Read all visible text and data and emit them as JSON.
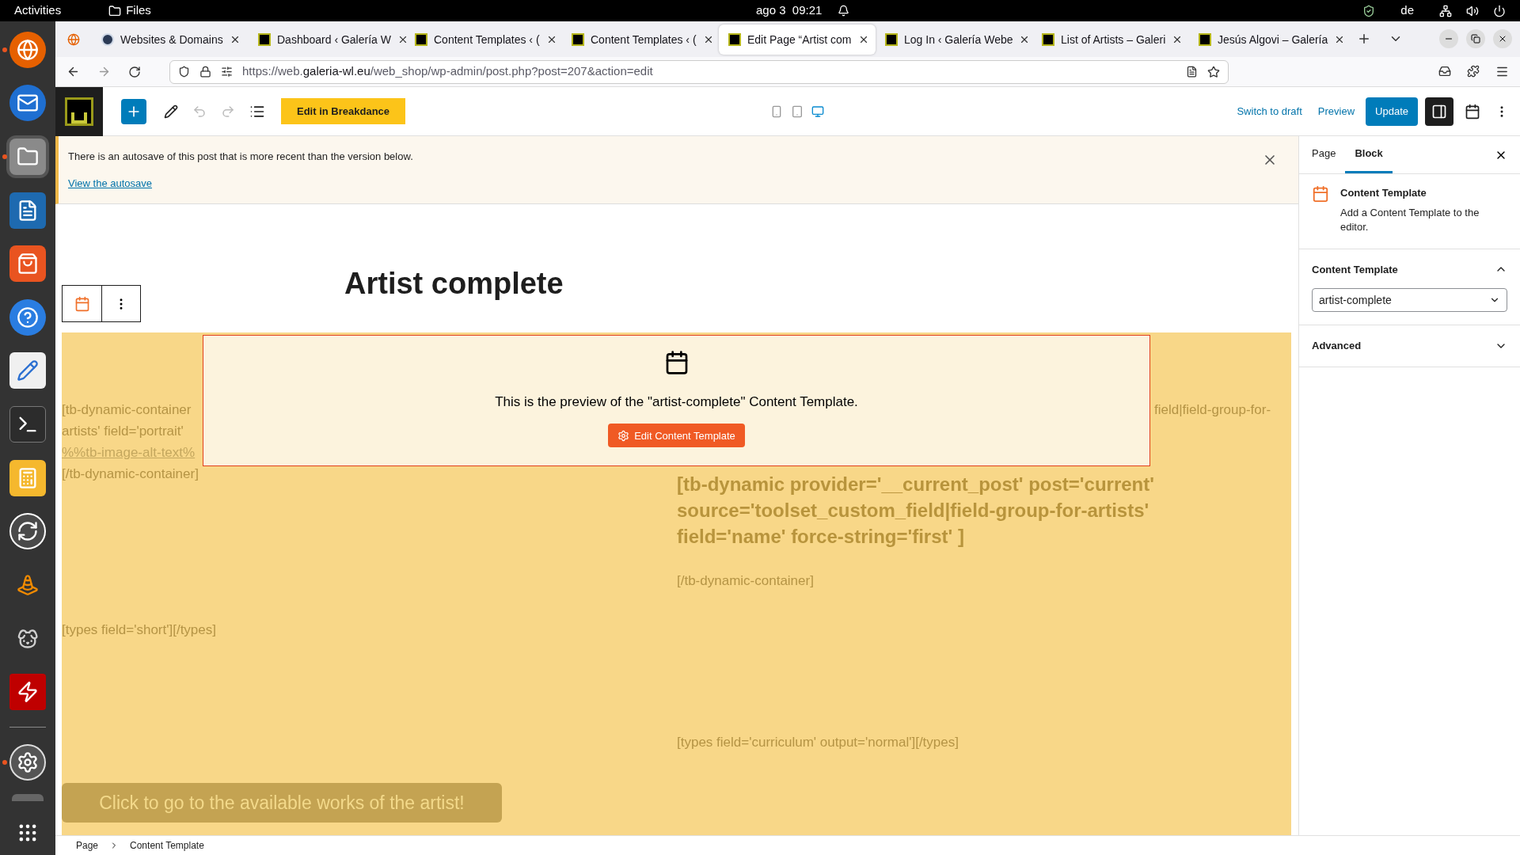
{
  "top_bar": {
    "activities": "Activities",
    "app_name": "Files",
    "clock": "ago 3  09:21",
    "keyboard_layout": "de"
  },
  "dock": [
    {
      "kind": "browser",
      "running": true
    },
    {
      "kind": "mail",
      "running": false
    },
    {
      "kind": "files",
      "running": true
    },
    {
      "kind": "writer",
      "running": false
    },
    {
      "kind": "store",
      "running": false
    },
    {
      "kind": "help",
      "running": false
    },
    {
      "kind": "editor",
      "running": false
    },
    {
      "kind": "terminal",
      "running": false
    },
    {
      "kind": "calculator",
      "running": false
    },
    {
      "kind": "updater",
      "running": false
    },
    {
      "kind": "cone",
      "running": false
    },
    {
      "kind": "dog",
      "running": false
    },
    {
      "kind": "transfer",
      "running": false
    },
    {
      "kind": "divider"
    },
    {
      "kind": "settings",
      "running": true
    },
    {
      "kind": "handle"
    },
    {
      "kind": "apps",
      "running": false
    }
  ],
  "browser": {
    "tabs": [
      {
        "title": "Websites & Domains",
        "selected": false
      },
      {
        "title": "Dashboard ‹ Galería W",
        "selected": false
      },
      {
        "title": "Content Templates ‹ (",
        "selected": false
      },
      {
        "title": "Content Templates ‹ (",
        "selected": false
      },
      {
        "title": "Edit Page “Artist com",
        "selected": true
      },
      {
        "title": "Log In ‹ Galería Webe",
        "selected": false
      },
      {
        "title": "List of Artists – Galeri",
        "selected": false
      },
      {
        "title": "Jesús Algovi – Galería",
        "selected": false
      }
    ],
    "url": {
      "prefix": "https://web.",
      "domain": "galeria-wl.eu",
      "path": "/web_shop/wp-admin/post.php?post=207&action=edit"
    }
  },
  "wp_toolbar": {
    "undo": {
      "disabled": true
    },
    "redo": {
      "disabled": true
    },
    "breakdance_button": "Edit in Breakdance",
    "devices": [
      {
        "kind": "mobile",
        "selected": false
      },
      {
        "kind": "tablet",
        "selected": false
      },
      {
        "kind": "desktop",
        "selected": true
      }
    ],
    "switch_to_draft": "Switch to draft",
    "preview": "Preview",
    "update": "Update",
    "settings_toggle": {
      "pressed": true
    }
  },
  "notice": {
    "message": "There is an autosave of this post that is more recent than the version below.",
    "link": "View the autosave"
  },
  "page_title": "Artist complete",
  "template_block": {
    "left_lines": [
      {
        "kind": "text",
        "text": "[tb-dynamic-container"
      },
      {
        "kind": "text",
        "text": "artists' field='portrait'"
      },
      {
        "kind": "link",
        "text": "%%tb-image-alt-text%"
      },
      {
        "kind": "text",
        "text": "[/tb-dynamic-container]"
      }
    ],
    "short_field": "[types field='short'][/types]",
    "right_lines": [
      "field|field-group-for-"
    ],
    "heading": "[tb-dynamic provider='__current_post' post='current' source='toolset_custom_field|field-group-for-artists' field='name' force-string='first' ]",
    "right_closing": "[/tb-dynamic-container]",
    "curriculum_field": "[types field='curriculum' output='normal'][/types]",
    "works_button": "Click to go to the available works of the artist!",
    "preview_message": "This is the preview of the \"artist-complete\" Content Template.",
    "edit_button": "Edit Content Template"
  },
  "sidebar": {
    "tabs": [
      {
        "label": "Page",
        "selected": false
      },
      {
        "label": "Block",
        "selected": true
      }
    ],
    "block_title": "Content Template",
    "block_description": "Add a Content Template to the editor.",
    "panels": [
      {
        "title": "Content Template",
        "expanded": true,
        "select_value": "artist-complete"
      },
      {
        "title": "Advanced",
        "expanded": false
      }
    ]
  },
  "breadcrumb": [
    "Page",
    "Content Template"
  ]
}
